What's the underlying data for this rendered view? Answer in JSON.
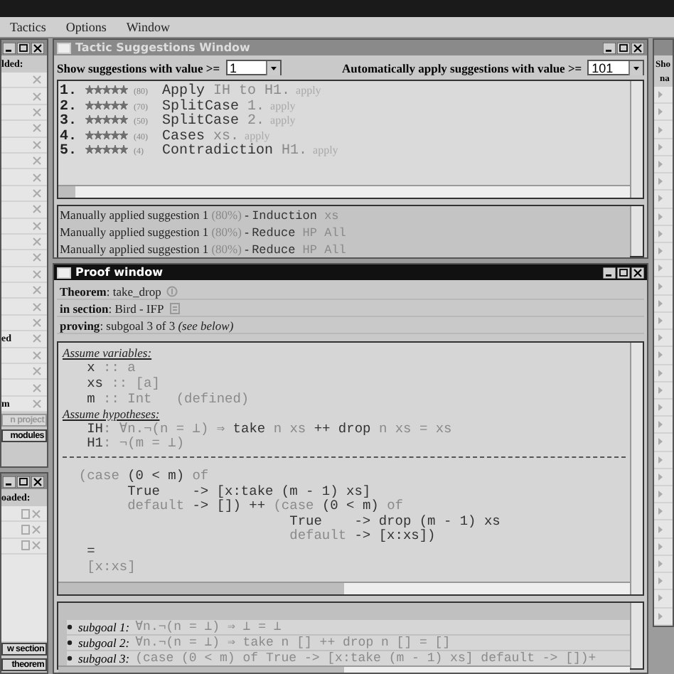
{
  "menu": [
    {
      "label": "Tactics"
    },
    {
      "label": "Options"
    },
    {
      "label": "Window"
    }
  ],
  "left_panel": {
    "heading": "lded:",
    "rows": [
      {
        "kind": "blank"
      },
      {
        "kind": "blank"
      },
      {
        "kind": "blank"
      },
      {
        "kind": "blank"
      },
      {
        "kind": "blank"
      },
      {
        "kind": "blank"
      },
      {
        "kind": "blank"
      },
      {
        "kind": "blank"
      },
      {
        "kind": "blank"
      },
      {
        "kind": "blank"
      },
      {
        "kind": "blank"
      },
      {
        "kind": "blank"
      },
      {
        "kind": "blank"
      },
      {
        "kind": "blank"
      },
      {
        "kind": "blank"
      },
      {
        "kind": "blank"
      },
      {
        "kind": "named",
        "label": "ed"
      },
      {
        "kind": "blank"
      },
      {
        "kind": "blank"
      },
      {
        "kind": "blank"
      },
      {
        "kind": "named",
        "label": "m"
      }
    ],
    "buttons": [
      {
        "label": "n project",
        "disabled": true
      },
      {
        "label": "modules",
        "disabled": false
      }
    ],
    "lower_heading": "oaded:",
    "lower_buttons": [
      {
        "label": "w section",
        "disabled": false
      },
      {
        "label": "theorem",
        "disabled": false
      }
    ]
  },
  "suggestions_window": {
    "title": "Tactic Suggestions Window",
    "active": false,
    "show_label": "Show suggestions with value >=",
    "show_value": "1",
    "auto_label": "Automatically apply suggestions with value >=",
    "auto_value": "101",
    "suggestions": [
      {
        "number": "1.",
        "stars": 5,
        "score": "(80)",
        "tactic": [
          {
            "text": "Apply ",
            "kind": "code"
          },
          {
            "text": "IH to H1.",
            "kind": "faded"
          }
        ],
        "action": "apply"
      },
      {
        "number": "2.",
        "stars": 5,
        "score": "(70)",
        "tactic": [
          {
            "text": "SplitCase ",
            "kind": "code"
          },
          {
            "text": "1.",
            "kind": "faded"
          }
        ],
        "action": "apply"
      },
      {
        "number": "3.",
        "stars": 5,
        "score": "(50)",
        "tactic": [
          {
            "text": "SplitCase ",
            "kind": "code"
          },
          {
            "text": "2.",
            "kind": "faded"
          }
        ],
        "action": "apply"
      },
      {
        "number": "4.",
        "stars": 5,
        "score": "(40)",
        "tactic": [
          {
            "text": "Cases ",
            "kind": "code"
          },
          {
            "text": "xs.",
            "kind": "faded"
          }
        ],
        "action": "apply"
      },
      {
        "number": "5.",
        "stars": 5,
        "score": "(4)",
        "tactic": [
          {
            "text": "Contradiction ",
            "kind": "code"
          },
          {
            "text": "H1.",
            "kind": "faded"
          }
        ],
        "action": "apply"
      }
    ],
    "log": [
      [
        {
          "text": "Manually applied suggestion 1",
          "kind": "plain"
        },
        {
          "text": " (80%)",
          "kind": "faded-plain"
        },
        {
          "text": " - ",
          "kind": "plain"
        },
        {
          "text": "Induction ",
          "kind": "code"
        },
        {
          "text": "xs",
          "kind": "faded"
        }
      ],
      [
        {
          "text": "Manually applied suggestion 1",
          "kind": "plain"
        },
        {
          "text": " (80%)",
          "kind": "faded-plain"
        },
        {
          "text": " - ",
          "kind": "plain"
        },
        {
          "text": "Reduce ",
          "kind": "code"
        },
        {
          "text": "HP All",
          "kind": "faded"
        }
      ],
      [
        {
          "text": "Manually applied suggestion 1",
          "kind": "plain"
        },
        {
          "text": " (80%)",
          "kind": "faded-plain"
        },
        {
          "text": " - ",
          "kind": "plain"
        },
        {
          "text": "Reduce ",
          "kind": "code"
        },
        {
          "text": "HP All",
          "kind": "faded"
        }
      ]
    ]
  },
  "proof_window": {
    "title": "Proof window",
    "active": true,
    "info": [
      [
        {
          "text": "Theorem",
          "kind": "label"
        },
        {
          "text": ": take_drop",
          "kind": "plain"
        }
      ],
      [
        {
          "text": "in section",
          "kind": "label"
        },
        {
          "text": ": Bird - IFP",
          "kind": "plain"
        }
      ],
      [
        {
          "text": "proving",
          "kind": "label"
        },
        {
          "text": ": subgoal 3 of 3 ",
          "kind": "plain"
        },
        {
          "text": "(see below)",
          "kind": "italic"
        }
      ]
    ],
    "lines": [
      [
        {
          "text": "Assume variables:",
          "kind": "heading"
        }
      ],
      [
        {
          "text": "   x ",
          "kind": "code"
        },
        {
          "text": ":: a",
          "kind": "faded"
        }
      ],
      [
        {
          "text": "   xs ",
          "kind": "code"
        },
        {
          "text": ":: [a]",
          "kind": "faded"
        }
      ],
      [
        {
          "text": "   m ",
          "kind": "code"
        },
        {
          "text": ":: Int   (defined)",
          "kind": "faded"
        }
      ],
      [
        {
          "text": "Assume hypotheses:",
          "kind": "heading"
        }
      ],
      [
        {
          "text": "   IH",
          "kind": "code"
        },
        {
          "text": ": ∀n.¬(n = ⊥) ⇒ ",
          "kind": "faded"
        },
        {
          "text": "take ",
          "kind": "code"
        },
        {
          "text": "n xs ",
          "kind": "faded"
        },
        {
          "text": "++ drop ",
          "kind": "code"
        },
        {
          "text": "n xs = xs",
          "kind": "faded"
        }
      ],
      [
        {
          "text": "   H1",
          "kind": "code"
        },
        {
          "text": ": ¬(m = ⊥)",
          "kind": "faded"
        }
      ],
      [
        {
          "kind": "separator"
        }
      ],
      [
        {
          "text": "  (case ",
          "kind": "faded"
        },
        {
          "text": "(0 < m) ",
          "kind": "code"
        },
        {
          "text": "of",
          "kind": "faded"
        }
      ],
      [
        {
          "text": "        True    -> [x:take (m - 1) xs]",
          "kind": "code"
        }
      ],
      [
        {
          "text": "        default ",
          "kind": "faded"
        },
        {
          "text": "-> []) ++ ",
          "kind": "code"
        },
        {
          "text": "(case ",
          "kind": "faded"
        },
        {
          "text": "(0 < m) ",
          "kind": "code"
        },
        {
          "text": "of",
          "kind": "faded"
        }
      ],
      [
        {
          "text": "                            True    -> drop (m - 1) xs",
          "kind": "code"
        }
      ],
      [
        {
          "text": "                            default ",
          "kind": "faded"
        },
        {
          "text": "-> [x:xs])",
          "kind": "code"
        }
      ],
      [
        {
          "text": "   =",
          "kind": "code"
        }
      ],
      [
        {
          "text": "   [x:xs]",
          "kind": "faded"
        }
      ]
    ],
    "subgoals": [
      {
        "label": "subgoal 1:",
        "formula": "∀n.¬(n = ⊥) ⇒ ⊥ = ⊥"
      },
      {
        "label": "subgoal 2:",
        "formula": "∀n.¬(n = ⊥) ⇒ take n [] ++ drop n [] = []"
      },
      {
        "label": "subgoal 3:",
        "formula": "(case (0 < m) of  True -> [x:take (m - 1) xs]  default -> [])+"
      }
    ]
  },
  "right_panel": {
    "heading": "Sho",
    "column_1": "na"
  }
}
